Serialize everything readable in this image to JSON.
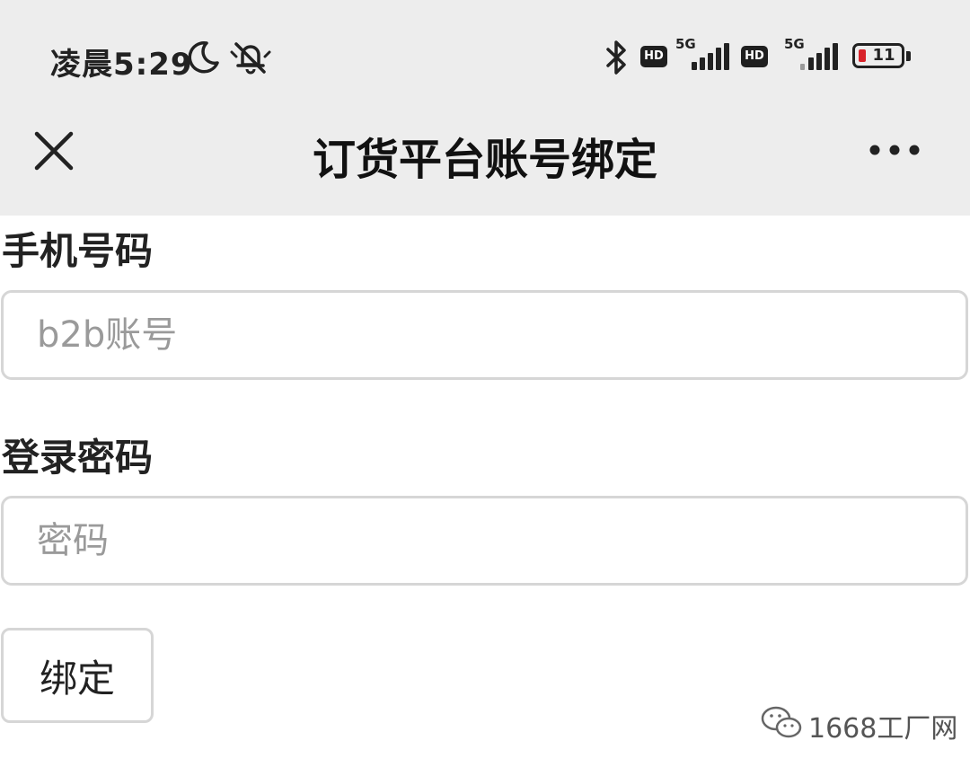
{
  "status_bar": {
    "time": "凌晨5:29",
    "hd_badge_1": "HD",
    "hd_badge_2": "HD",
    "network_1": "5G",
    "network_2": "5G",
    "battery_level": "11",
    "icons": [
      "moon-icon",
      "bell-muted-icon",
      "bluetooth-icon",
      "signal-icon",
      "battery-icon"
    ]
  },
  "header": {
    "title": "订货平台账号绑定",
    "close_icon": "close-icon",
    "more_icon": "more-icon"
  },
  "form": {
    "phone_label": "手机号码",
    "phone_placeholder": "b2b账号",
    "phone_value": "",
    "password_label": "登录密码",
    "password_placeholder": "密码",
    "password_value": "",
    "bind_button_label": "绑定"
  },
  "watermark": {
    "text": "1668工厂网",
    "icon": "wechat-icon"
  },
  "colors": {
    "header_bg": "#ededed",
    "page_bg": "#ffffff",
    "border": "#d6d6d6",
    "placeholder": "#9a9a9a",
    "battery_low": "#d8232a"
  }
}
